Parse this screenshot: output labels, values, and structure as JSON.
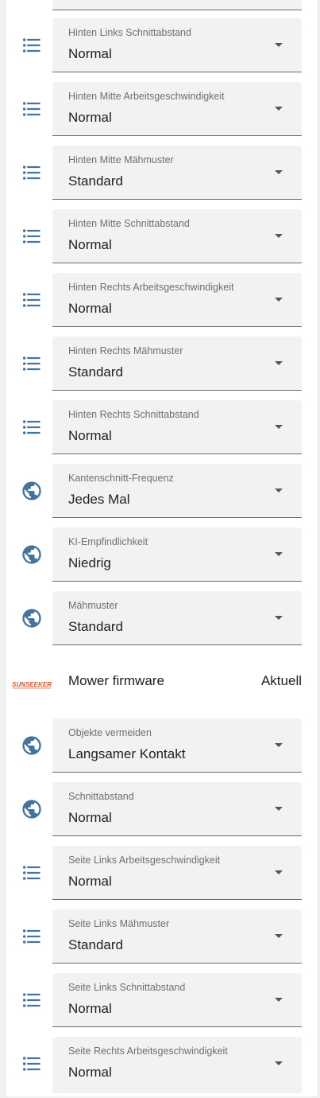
{
  "colors": {
    "icon": "#44739e",
    "brand": "#e8531f"
  },
  "rows": [
    {
      "type": "select",
      "icon": "list-icon",
      "label": "Hinten Links Schnittabstand",
      "value": "Normal"
    },
    {
      "type": "select",
      "icon": "list-icon",
      "label": "Hinten Mitte Arbeitsgeschwindigkeit",
      "value": "Normal"
    },
    {
      "type": "select",
      "icon": "list-icon",
      "label": "Hinten Mitte Mähmuster",
      "value": "Standard"
    },
    {
      "type": "select",
      "icon": "list-icon",
      "label": "Hinten Mitte Schnittabstand",
      "value": "Normal"
    },
    {
      "type": "select",
      "icon": "list-icon",
      "label": "Hinten Rechts Arbeitsgeschwindigkeit",
      "value": "Normal"
    },
    {
      "type": "select",
      "icon": "list-icon",
      "label": "Hinten Rechts Mähmuster",
      "value": "Standard"
    },
    {
      "type": "select",
      "icon": "list-icon",
      "label": "Hinten Rechts Schnittabstand",
      "value": "Normal"
    },
    {
      "type": "select",
      "icon": "globe-icon",
      "label": "Kantenschnitt-Frequenz",
      "value": "Jedes Mal"
    },
    {
      "type": "select",
      "icon": "globe-icon",
      "label": "KI-Empfindlichkeit",
      "value": "Niedrig"
    },
    {
      "type": "select",
      "icon": "globe-icon",
      "label": "Mähmuster",
      "value": "Standard"
    },
    {
      "type": "info",
      "icon": "sunseeker-logo",
      "brand_text": "SUNSEEKER",
      "label": "Mower firmware",
      "value": "Aktuell"
    },
    {
      "type": "select",
      "icon": "globe-icon",
      "label": "Objekte vermeiden",
      "value": "Langsamer Kontakt"
    },
    {
      "type": "select",
      "icon": "globe-icon",
      "label": "Schnittabstand",
      "value": "Normal"
    },
    {
      "type": "select",
      "icon": "list-icon",
      "label": "Seite Links Arbeitsgeschwindigkeit",
      "value": "Normal"
    },
    {
      "type": "select",
      "icon": "list-icon",
      "label": "Seite Links Mähmuster",
      "value": "Standard"
    },
    {
      "type": "select",
      "icon": "list-icon",
      "label": "Seite Links Schnittabstand",
      "value": "Normal"
    },
    {
      "type": "select",
      "icon": "list-icon",
      "label": "Seite Rechts Arbeitsgeschwindigkeit",
      "value": "Normal"
    }
  ]
}
